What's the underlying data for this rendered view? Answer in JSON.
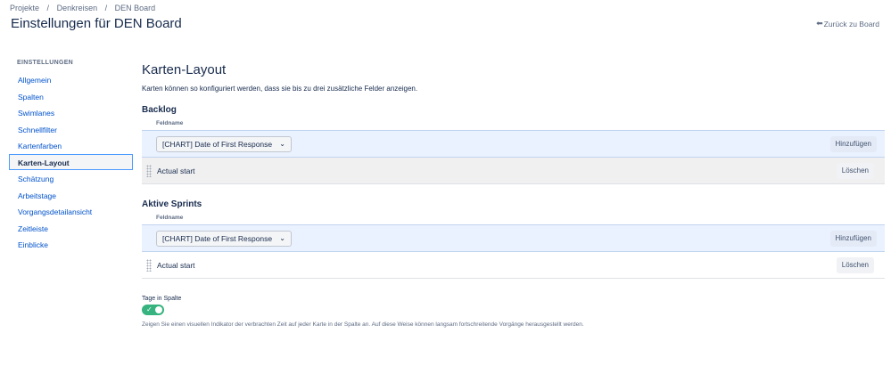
{
  "breadcrumb": {
    "items": [
      "Projekte",
      "Denkreisen",
      "DEN Board"
    ],
    "separator": "/"
  },
  "header": {
    "title": "Einstellungen für DEN Board",
    "back_link": "Zurück zu Board"
  },
  "sidebar": {
    "heading": "EINSTELLUNGEN",
    "items": [
      {
        "label": "Allgemein"
      },
      {
        "label": "Spalten"
      },
      {
        "label": "Swimlanes"
      },
      {
        "label": "Schnellfilter"
      },
      {
        "label": "Kartenfarben"
      },
      {
        "label": "Karten-Layout",
        "active": true
      },
      {
        "label": "Schätzung"
      },
      {
        "label": "Arbeitstage"
      },
      {
        "label": "Vorgangsdetailansicht"
      },
      {
        "label": "Zeitleiste"
      },
      {
        "label": "Einblicke"
      }
    ]
  },
  "main": {
    "title": "Karten-Layout",
    "description": "Karten können so konfiguriert werden, dass sie bis zu drei zusätzliche Felder anzeigen.",
    "sections": [
      {
        "title": "Backlog",
        "column_header": "Feldname",
        "select_value": "[CHART] Date of First Response",
        "add_button": "Hinzufügen",
        "fields": [
          {
            "name": "Actual start",
            "delete_button": "Löschen"
          }
        ]
      },
      {
        "title": "Aktive Sprints",
        "column_header": "Feldname",
        "select_value": "[CHART] Date of First Response",
        "add_button": "Hinzufügen",
        "fields": [
          {
            "name": "Actual start",
            "delete_button": "Löschen"
          }
        ]
      }
    ],
    "days_in_column": {
      "label": "Tage in Spalte",
      "enabled": true,
      "description": "Zeigen Sie einen visuellen Indikator der verbrachten Zeit auf jeder Karte in der Spalte an. Auf diese Weise können langsam fortschreitende Vorgänge herausgestellt werden."
    }
  },
  "colors": {
    "link": "#0052cc",
    "toggle_on": "#36b37e",
    "active_border": "#4c9aff",
    "add_row_bg": "#ebf2ff"
  },
  "icons": {
    "back": "arrow-left-icon",
    "select": "chevron-down-icon",
    "drag": "drag-handle-icon",
    "toggle": "check-icon"
  }
}
